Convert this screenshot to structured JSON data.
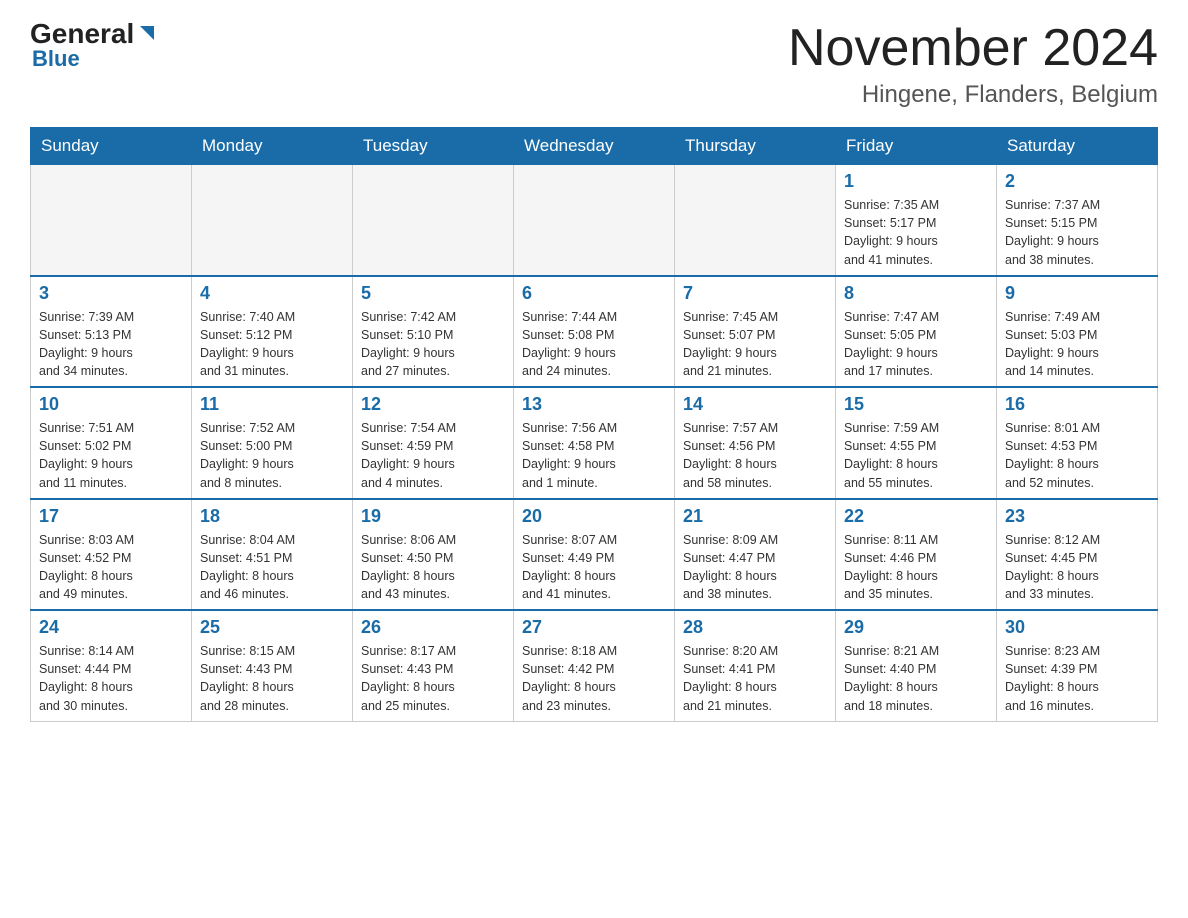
{
  "logo": {
    "general": "General",
    "blue": "Blue"
  },
  "header": {
    "month": "November 2024",
    "location": "Hingene, Flanders, Belgium"
  },
  "days_of_week": [
    "Sunday",
    "Monday",
    "Tuesday",
    "Wednesday",
    "Thursday",
    "Friday",
    "Saturday"
  ],
  "weeks": [
    [
      {
        "day": "",
        "info": ""
      },
      {
        "day": "",
        "info": ""
      },
      {
        "day": "",
        "info": ""
      },
      {
        "day": "",
        "info": ""
      },
      {
        "day": "",
        "info": ""
      },
      {
        "day": "1",
        "info": "Sunrise: 7:35 AM\nSunset: 5:17 PM\nDaylight: 9 hours\nand 41 minutes."
      },
      {
        "day": "2",
        "info": "Sunrise: 7:37 AM\nSunset: 5:15 PM\nDaylight: 9 hours\nand 38 minutes."
      }
    ],
    [
      {
        "day": "3",
        "info": "Sunrise: 7:39 AM\nSunset: 5:13 PM\nDaylight: 9 hours\nand 34 minutes."
      },
      {
        "day": "4",
        "info": "Sunrise: 7:40 AM\nSunset: 5:12 PM\nDaylight: 9 hours\nand 31 minutes."
      },
      {
        "day": "5",
        "info": "Sunrise: 7:42 AM\nSunset: 5:10 PM\nDaylight: 9 hours\nand 27 minutes."
      },
      {
        "day": "6",
        "info": "Sunrise: 7:44 AM\nSunset: 5:08 PM\nDaylight: 9 hours\nand 24 minutes."
      },
      {
        "day": "7",
        "info": "Sunrise: 7:45 AM\nSunset: 5:07 PM\nDaylight: 9 hours\nand 21 minutes."
      },
      {
        "day": "8",
        "info": "Sunrise: 7:47 AM\nSunset: 5:05 PM\nDaylight: 9 hours\nand 17 minutes."
      },
      {
        "day": "9",
        "info": "Sunrise: 7:49 AM\nSunset: 5:03 PM\nDaylight: 9 hours\nand 14 minutes."
      }
    ],
    [
      {
        "day": "10",
        "info": "Sunrise: 7:51 AM\nSunset: 5:02 PM\nDaylight: 9 hours\nand 11 minutes."
      },
      {
        "day": "11",
        "info": "Sunrise: 7:52 AM\nSunset: 5:00 PM\nDaylight: 9 hours\nand 8 minutes."
      },
      {
        "day": "12",
        "info": "Sunrise: 7:54 AM\nSunset: 4:59 PM\nDaylight: 9 hours\nand 4 minutes."
      },
      {
        "day": "13",
        "info": "Sunrise: 7:56 AM\nSunset: 4:58 PM\nDaylight: 9 hours\nand 1 minute."
      },
      {
        "day": "14",
        "info": "Sunrise: 7:57 AM\nSunset: 4:56 PM\nDaylight: 8 hours\nand 58 minutes."
      },
      {
        "day": "15",
        "info": "Sunrise: 7:59 AM\nSunset: 4:55 PM\nDaylight: 8 hours\nand 55 minutes."
      },
      {
        "day": "16",
        "info": "Sunrise: 8:01 AM\nSunset: 4:53 PM\nDaylight: 8 hours\nand 52 minutes."
      }
    ],
    [
      {
        "day": "17",
        "info": "Sunrise: 8:03 AM\nSunset: 4:52 PM\nDaylight: 8 hours\nand 49 minutes."
      },
      {
        "day": "18",
        "info": "Sunrise: 8:04 AM\nSunset: 4:51 PM\nDaylight: 8 hours\nand 46 minutes."
      },
      {
        "day": "19",
        "info": "Sunrise: 8:06 AM\nSunset: 4:50 PM\nDaylight: 8 hours\nand 43 minutes."
      },
      {
        "day": "20",
        "info": "Sunrise: 8:07 AM\nSunset: 4:49 PM\nDaylight: 8 hours\nand 41 minutes."
      },
      {
        "day": "21",
        "info": "Sunrise: 8:09 AM\nSunset: 4:47 PM\nDaylight: 8 hours\nand 38 minutes."
      },
      {
        "day": "22",
        "info": "Sunrise: 8:11 AM\nSunset: 4:46 PM\nDaylight: 8 hours\nand 35 minutes."
      },
      {
        "day": "23",
        "info": "Sunrise: 8:12 AM\nSunset: 4:45 PM\nDaylight: 8 hours\nand 33 minutes."
      }
    ],
    [
      {
        "day": "24",
        "info": "Sunrise: 8:14 AM\nSunset: 4:44 PM\nDaylight: 8 hours\nand 30 minutes."
      },
      {
        "day": "25",
        "info": "Sunrise: 8:15 AM\nSunset: 4:43 PM\nDaylight: 8 hours\nand 28 minutes."
      },
      {
        "day": "26",
        "info": "Sunrise: 8:17 AM\nSunset: 4:43 PM\nDaylight: 8 hours\nand 25 minutes."
      },
      {
        "day": "27",
        "info": "Sunrise: 8:18 AM\nSunset: 4:42 PM\nDaylight: 8 hours\nand 23 minutes."
      },
      {
        "day": "28",
        "info": "Sunrise: 8:20 AM\nSunset: 4:41 PM\nDaylight: 8 hours\nand 21 minutes."
      },
      {
        "day": "29",
        "info": "Sunrise: 8:21 AM\nSunset: 4:40 PM\nDaylight: 8 hours\nand 18 minutes."
      },
      {
        "day": "30",
        "info": "Sunrise: 8:23 AM\nSunset: 4:39 PM\nDaylight: 8 hours\nand 16 minutes."
      }
    ]
  ]
}
